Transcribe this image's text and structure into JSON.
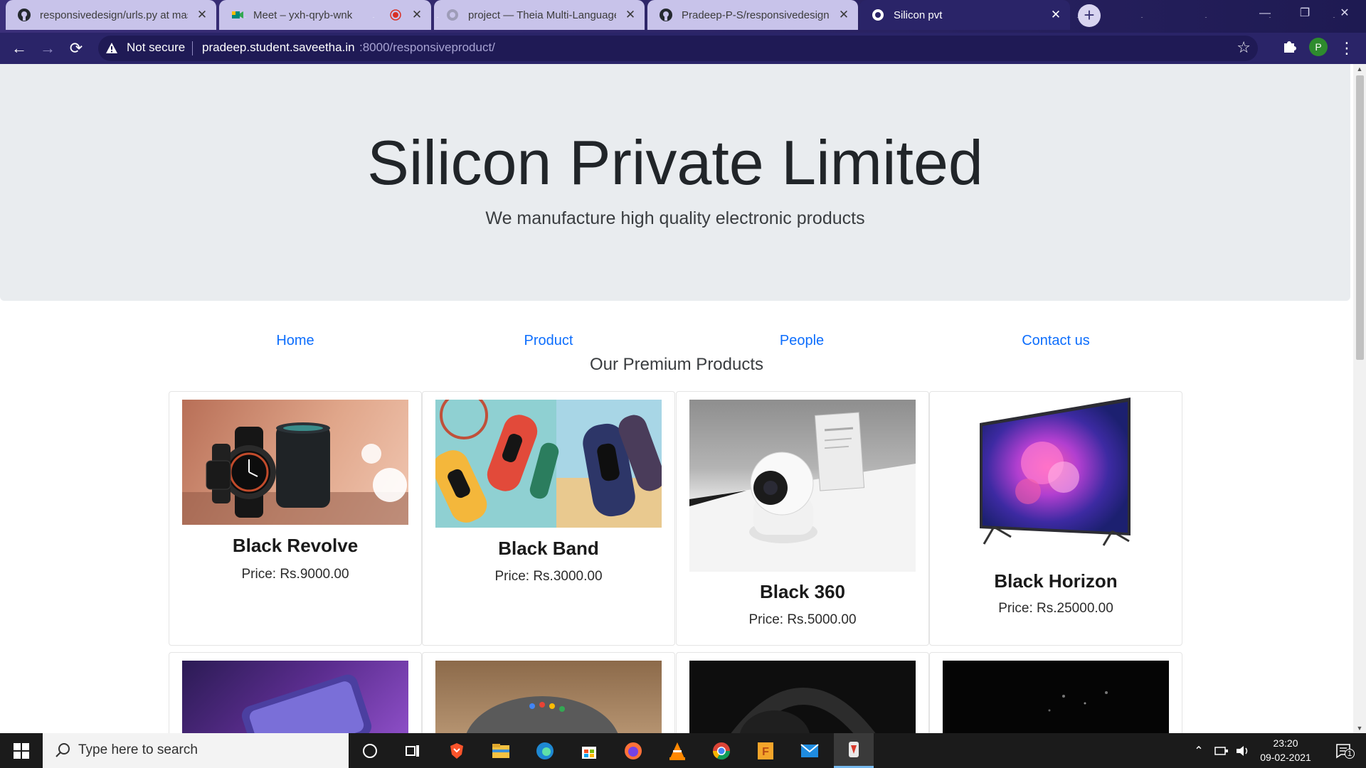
{
  "browser": {
    "tabs": [
      {
        "title": "responsivedesign/urls.py at mast",
        "icon": "github-icon",
        "active": false
      },
      {
        "title": "Meet – yxh-qryb-wnk",
        "icon": "google-meet-icon",
        "active": false
      },
      {
        "title": "project — Theia Multi-Language",
        "icon": "globe-icon",
        "active": false
      },
      {
        "title": "Pradeep-P-S/responsivedesign",
        "icon": "github-icon",
        "active": false
      },
      {
        "title": "Silicon pvt",
        "icon": "globe-icon",
        "active": true
      }
    ],
    "address_bar": {
      "security_label": "Not secure",
      "host": "pradeep.student.saveetha.in",
      "path": ":8000/responsiveproduct/"
    },
    "profile_initial": "P"
  },
  "page": {
    "hero": {
      "title": "Silicon Private Limited",
      "subtitle": "We manufacture high quality electronic products"
    },
    "nav": [
      "Home",
      "Product",
      "People",
      "Contact us"
    ],
    "section_title": "Our Premium Products",
    "products": [
      {
        "name": "Black Revolve",
        "price": "Price: Rs.9000.00"
      },
      {
        "name": "Black Band",
        "price": "Price: Rs.3000.00"
      },
      {
        "name": "Black 360",
        "price": "Price: Rs.5000.00"
      },
      {
        "name": "Black Horizon",
        "price": "Price: Rs.25000.00"
      }
    ]
  },
  "taskbar": {
    "search_placeholder": "Type here to search",
    "apps": [
      "cortana-icon",
      "task-view-icon",
      "brave-icon",
      "file-explorer-icon",
      "edge-icon",
      "store-icon",
      "firefox-icon",
      "vlc-icon",
      "chrome-icon",
      "foxit-icon",
      "mail-icon",
      "app-icon"
    ],
    "clock": {
      "time": "23:20",
      "date": "09-02-2021"
    },
    "notification_count": "1"
  },
  "colors": {
    "tab_bar": "#2c2466",
    "link": "#0d6efd",
    "jumbotron": "#e9ecef",
    "taskbar": "#1b1b1b"
  }
}
